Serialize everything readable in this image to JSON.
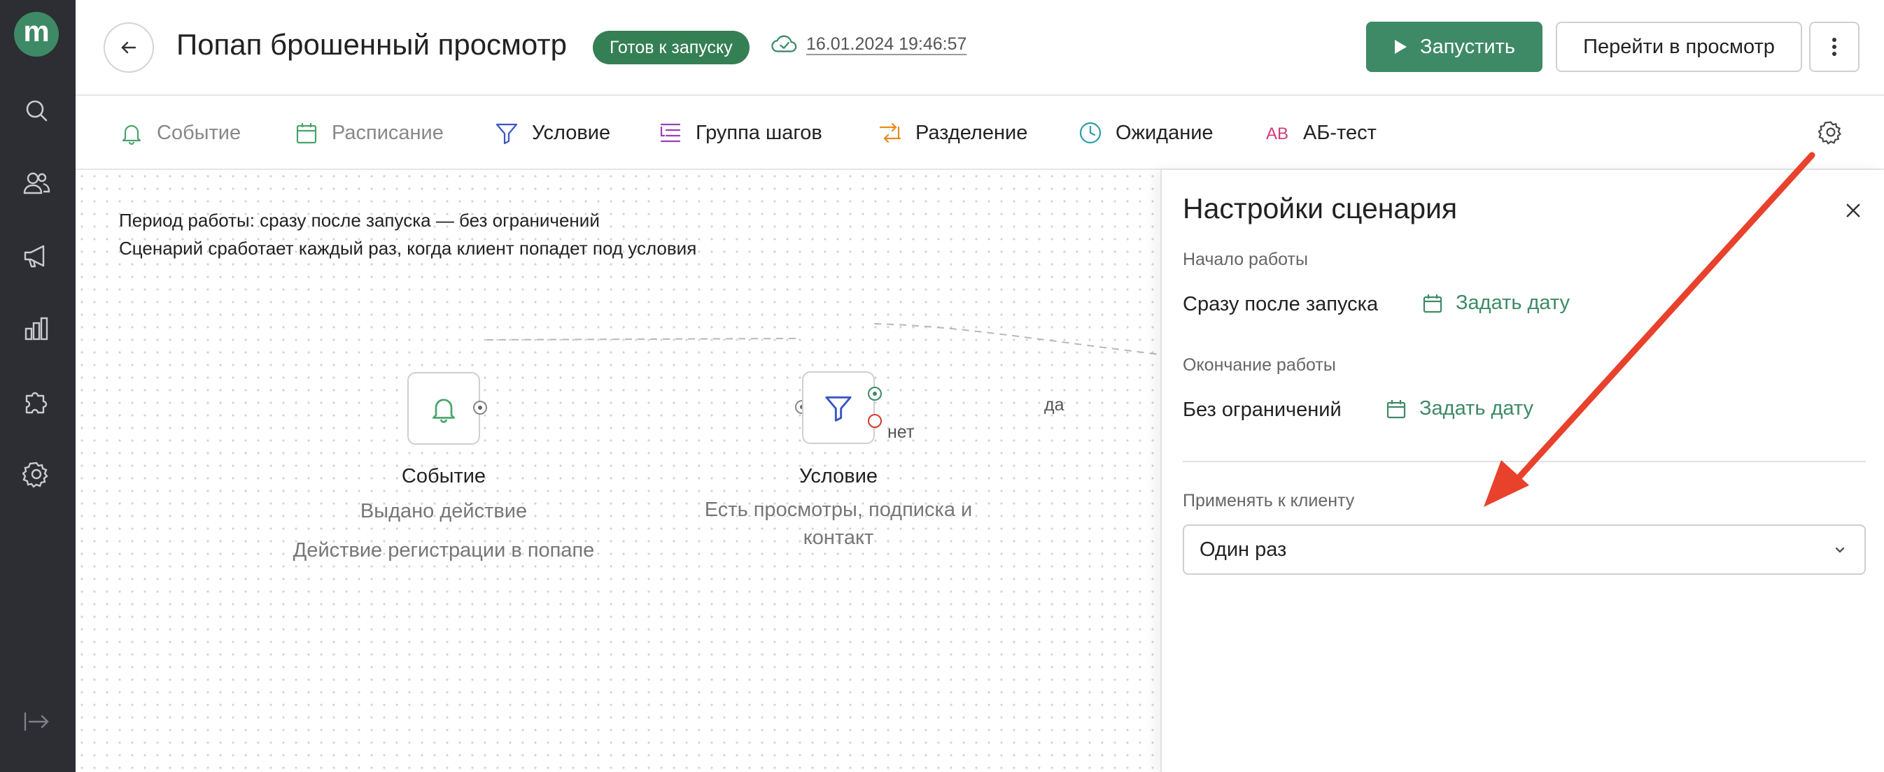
{
  "app": {
    "logo_letter": "m"
  },
  "sidebar": {
    "items": [
      {
        "icon": "search-icon"
      },
      {
        "icon": "users-icon"
      },
      {
        "icon": "megaphone-icon"
      },
      {
        "icon": "bar-chart-icon"
      },
      {
        "icon": "puzzle-icon"
      },
      {
        "icon": "gear-icon"
      }
    ],
    "collapse_icon": "collapse-sidebar-icon"
  },
  "header": {
    "title": "Попап брошенный просмотр",
    "status": "Готов к запуску",
    "saved_at": "16.01.2024 19:46:57",
    "run_label": "Запустить",
    "preview_label": "Перейти в просмотр"
  },
  "toolbar": {
    "items": [
      {
        "label": "Событие",
        "icon": "bell-icon",
        "color": "#4aa36c"
      },
      {
        "label": "Расписание",
        "icon": "calendar-icon",
        "color": "#4aa36c"
      },
      {
        "label": "Условие",
        "icon": "filter-icon",
        "color": "#3a56c5"
      },
      {
        "label": "Группа шагов",
        "icon": "step-group-icon",
        "color": "#9b3fb8"
      },
      {
        "label": "Разделение",
        "icon": "split-icon",
        "color": "#e88a1a"
      },
      {
        "label": "Ожидание",
        "icon": "clock-icon",
        "color": "#2e9ea6"
      },
      {
        "label": "АБ-тест",
        "icon": "ab-icon",
        "color": "#d23b7a"
      }
    ]
  },
  "canvas": {
    "period_line": "Период работы: сразу после запуска — без ограничений",
    "trigger_line": "Сценарий сработает каждый раз, когда клиент попадет под условия",
    "nodes": [
      {
        "title": "Событие",
        "sub1": "Выдано действие",
        "sub2": "Действие регистрации в попапе"
      },
      {
        "title": "Условие",
        "sub1": "Есть просмотры, подписка и",
        "sub2": "контакт"
      }
    ],
    "edge_yes": "да",
    "edge_no": "нет"
  },
  "panel": {
    "title": "Настройки сценария",
    "start_label": "Начало работы",
    "start_value": "Сразу после запуска",
    "start_link": "Задать дату",
    "end_label": "Окончание работы",
    "end_value": "Без ограничений",
    "end_link": "Задать дату",
    "apply_label": "Применять к клиенту",
    "apply_value": "Один раз"
  },
  "colors": {
    "brand": "#3e8a66",
    "sidebar": "#2c2e33",
    "badge": "#357f55",
    "annotation_arrow": "#e8412c"
  }
}
